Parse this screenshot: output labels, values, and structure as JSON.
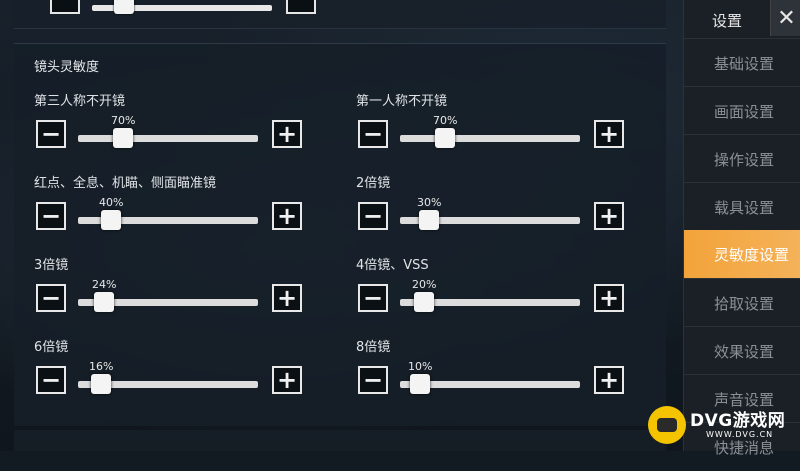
{
  "sidebar": {
    "title": "设置",
    "close_glyph": "✕",
    "items": [
      {
        "label": "基础设置"
      },
      {
        "label": "画面设置"
      },
      {
        "label": "操作设置"
      },
      {
        "label": "载具设置"
      },
      {
        "label": "灵敏度设置",
        "active": true
      },
      {
        "label": "拾取设置"
      },
      {
        "label": "效果设置"
      },
      {
        "label": "声音设置"
      },
      {
        "label": "快捷消息"
      }
    ]
  },
  "panel": {
    "title": "镜头灵敏度",
    "sliders": [
      {
        "label": "第三人称不开镜",
        "percent": "70%",
        "value": 0.7
      },
      {
        "label": "第一人称不开镜",
        "percent": "70%",
        "value": 0.7
      },
      {
        "label": "红点、全息、机瞄、侧面瞄准镜",
        "percent": "40%",
        "value": 0.4
      },
      {
        "label": "2倍镜",
        "percent": "30%",
        "value": 0.3
      },
      {
        "label": "3倍镜",
        "percent": "24%",
        "value": 0.24
      },
      {
        "label": "4倍镜、VSS",
        "percent": "20%",
        "value": 0.2
      },
      {
        "label": "6倍镜",
        "percent": "16%",
        "value": 0.16
      },
      {
        "label": "8倍镜",
        "percent": "10%",
        "value": 0.1
      }
    ],
    "minus_glyph": "−",
    "plus_glyph": "+"
  },
  "watermark": {
    "brand": "DVG游戏网",
    "url": "WWW.DVG.CN"
  },
  "colors": {
    "accent": "#f3a33a",
    "background": "#121a22"
  }
}
